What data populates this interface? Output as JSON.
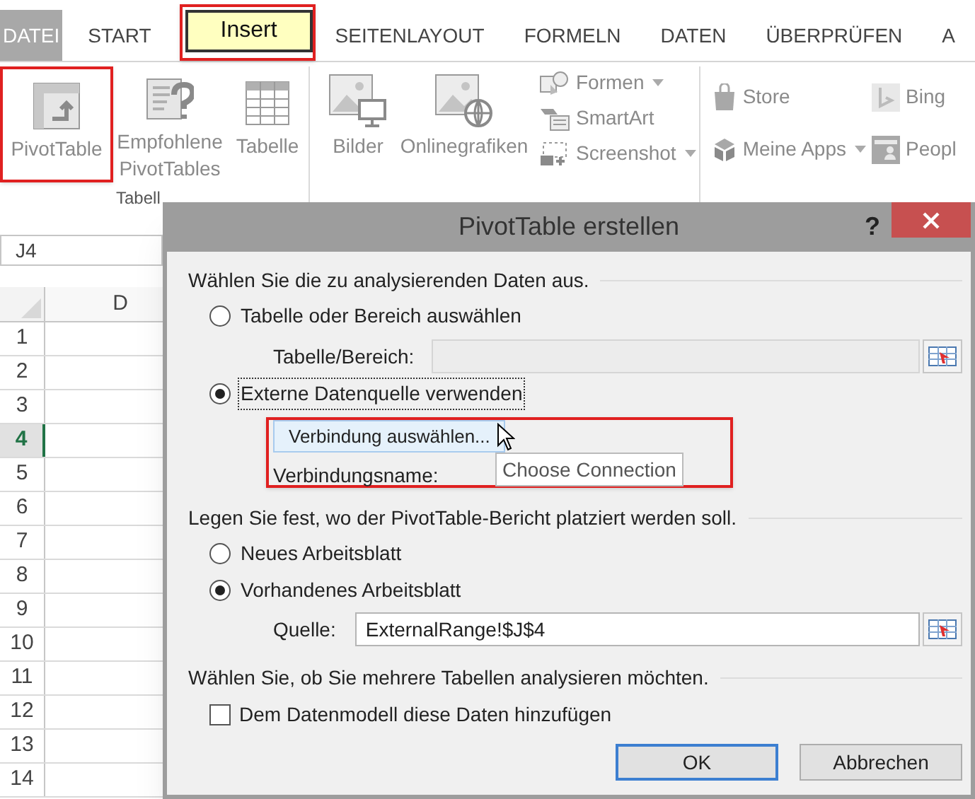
{
  "ribbon_tabs": [
    {
      "label": "DATEI",
      "kind": "file"
    },
    {
      "label": "START",
      "kind": "tab"
    },
    {
      "label": "Insert",
      "kind": "callout"
    },
    {
      "label": "SEITENLAYOUT",
      "kind": "tab"
    },
    {
      "label": "FORMELN",
      "kind": "tab"
    },
    {
      "label": "DATEN",
      "kind": "tab"
    },
    {
      "label": "ÜBERPRÜFEN",
      "kind": "tab"
    },
    {
      "label": "A",
      "kind": "tab"
    }
  ],
  "ribbon_groups": [
    {
      "label": "Tabell",
      "buttons": [
        {
          "kind": "large",
          "label": "PivotTable",
          "callout": true
        },
        {
          "kind": "large",
          "label": "Empfohlene PivotTables",
          "callout": false
        },
        {
          "kind": "large",
          "label": "Tabelle",
          "callout": false
        }
      ]
    },
    {
      "buttons": [
        {
          "kind": "large",
          "label": "Bilder",
          "callout": false
        },
        {
          "kind": "large",
          "label": "Onlinegrafiken",
          "callout": false
        },
        {
          "kind": "small",
          "label": "Formen",
          "dropdown": true
        },
        {
          "kind": "small",
          "label": "SmartArt",
          "dropdown": false
        },
        {
          "kind": "small",
          "label": "Screenshot",
          "dropdown": true
        }
      ]
    },
    {
      "buttons": [
        {
          "kind": "small",
          "label": "Store",
          "dropdown": false
        },
        {
          "kind": "small",
          "label": "Meine Apps",
          "dropdown": true
        },
        {
          "kind": "small",
          "label": "Bing",
          "dropdown": false
        },
        {
          "kind": "small",
          "label": "Peopl",
          "dropdown": false
        }
      ]
    }
  ],
  "name_box": "J4",
  "sheet": {
    "columns": [
      "D"
    ],
    "rows": [
      {
        "label": "1",
        "selected": false
      },
      {
        "label": "2",
        "selected": false
      },
      {
        "label": "3",
        "selected": false
      },
      {
        "label": "4",
        "selected": true
      },
      {
        "label": "5",
        "selected": false
      },
      {
        "label": "6",
        "selected": false
      },
      {
        "label": "7",
        "selected": false
      },
      {
        "label": "8",
        "selected": false
      },
      {
        "label": "9",
        "selected": false
      },
      {
        "label": "10",
        "selected": false
      },
      {
        "label": "11",
        "selected": false
      },
      {
        "label": "12",
        "selected": false
      },
      {
        "label": "13",
        "selected": false
      },
      {
        "label": "14",
        "selected": false
      }
    ]
  },
  "dialog": {
    "title": "PivotTable erstellen",
    "help": "?",
    "sections": [
      {
        "heading": "Wählen Sie die zu analysierenden Daten aus.",
        "items": [
          {
            "kind": "radio",
            "label": "Tabelle oder Bereich auswählen",
            "selected": false,
            "focused": false
          },
          {
            "kind": "range",
            "label": "Tabelle/Bereich:",
            "disabled": true
          },
          {
            "kind": "radio",
            "label": "Externe Datenquelle verwenden",
            "selected": true,
            "focused": true
          },
          {
            "kind": "connection",
            "button": "Verbindung auswählen...",
            "tooltip": "Choose Connection",
            "name_label": "Verbindungsname:",
            "callout": true
          }
        ]
      },
      {
        "heading": "Legen Sie fest, wo der PivotTable-Bericht platziert werden soll.",
        "items": [
          {
            "kind": "radio",
            "label": "Neues Arbeitsblatt",
            "selected": false,
            "focused": false
          },
          {
            "kind": "radio",
            "label": "Vorhandenes Arbeitsblatt",
            "selected": true,
            "focused": false
          },
          {
            "kind": "range",
            "label": "Quelle:",
            "value": "ExternalRange!$J$4",
            "disabled": false
          }
        ]
      },
      {
        "heading": "Wählen Sie, ob Sie mehrere Tabellen analysieren möchten.",
        "items": [
          {
            "kind": "checkbox",
            "label": "Dem Datenmodell diese Daten hinzufügen",
            "checked": false
          }
        ]
      }
    ],
    "buttons": [
      {
        "label": "OK",
        "default": true
      },
      {
        "label": "Abbrechen",
        "default": false
      }
    ]
  }
}
